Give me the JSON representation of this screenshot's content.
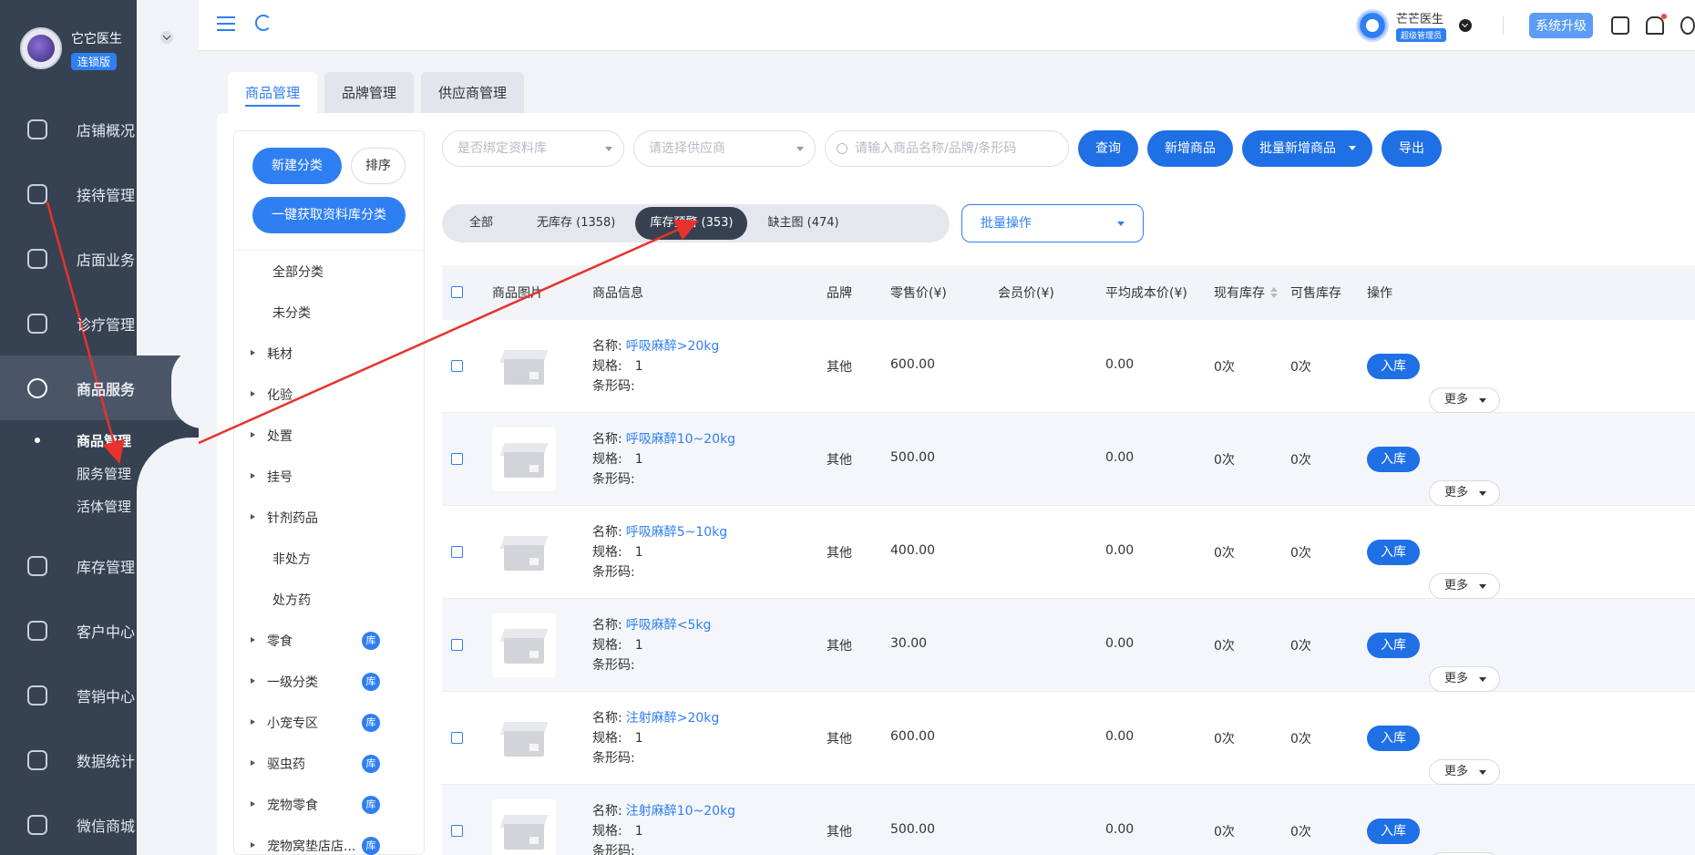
{
  "brand": {
    "name": "它它医生",
    "badge": "连锁版"
  },
  "sidebar": {
    "items": [
      {
        "label": "店铺概况",
        "icon": "store-overview-icon"
      },
      {
        "label": "接待管理",
        "icon": "reception-icon"
      },
      {
        "label": "店面业务",
        "icon": "storefront-icon"
      },
      {
        "label": "诊疗管理",
        "icon": "medical-kit-icon"
      },
      {
        "label": "商品服务",
        "icon": "goods-bag-icon"
      }
    ],
    "sub_items": [
      {
        "label": "商品管理",
        "active": true
      },
      {
        "label": "服务管理"
      },
      {
        "label": "活体管理"
      }
    ],
    "items_after": [
      {
        "label": "库存管理",
        "icon": "inventory-icon"
      },
      {
        "label": "客户中心",
        "icon": "customer-icon"
      },
      {
        "label": "营销中心",
        "icon": "marketing-icon"
      },
      {
        "label": "数据统计",
        "icon": "statistics-icon"
      },
      {
        "label": "微信商城",
        "icon": "wechat-mall-icon"
      }
    ]
  },
  "topbar": {
    "user_name": "芒芒医生",
    "user_role": "超级管理员",
    "upgrade_label": "系统升级"
  },
  "tabs": [
    {
      "label": "商品管理",
      "active": true
    },
    {
      "label": "品牌管理"
    },
    {
      "label": "供应商管理"
    }
  ],
  "categories": {
    "new_label": "新建分类",
    "sort_label": "排序",
    "fetch_label": "一键获取资料库分类",
    "list": [
      {
        "label": "全部分类",
        "type": "leaf"
      },
      {
        "label": "未分类",
        "type": "leaf"
      },
      {
        "label": "耗材",
        "type": "branch"
      },
      {
        "label": "化验",
        "type": "branch"
      },
      {
        "label": "处置",
        "type": "branch"
      },
      {
        "label": "挂号",
        "type": "branch"
      },
      {
        "label": "针剂药品",
        "type": "branch"
      },
      {
        "label": "非处方",
        "type": "leaf"
      },
      {
        "label": "处方药",
        "type": "leaf"
      },
      {
        "label": "零食",
        "type": "branch",
        "badge": "库"
      },
      {
        "label": "一级分类",
        "type": "branch",
        "badge": "库"
      },
      {
        "label": "小宠专区",
        "type": "branch",
        "badge": "库"
      },
      {
        "label": "驱虫药",
        "type": "branch",
        "badge": "库"
      },
      {
        "label": "宠物零食",
        "type": "branch",
        "badge": "库"
      },
      {
        "label": "宠物窝垫店店...",
        "type": "branch",
        "badge": "库"
      }
    ]
  },
  "filters": {
    "library_placeholder": "是否绑定资料库",
    "supplier_placeholder": "请选择供应商",
    "search_placeholder": "请输入商品名称/品牌/条形码",
    "query_label": "查询",
    "add_label": "新增商品",
    "batch_add_label": "批量新增商品",
    "export_label": "导出"
  },
  "status_tabs": [
    {
      "label": "全部"
    },
    {
      "label": "无库存 (1358)"
    },
    {
      "label": "库存预警 (353)",
      "active": true
    },
    {
      "label": "缺主图 (474)"
    }
  ],
  "batch_label": "批量操作",
  "table": {
    "headers": [
      "商品图片",
      "商品信息",
      "品牌",
      "零售价(¥)",
      "会员价(¥)",
      "平均成本价(¥)",
      "现有库存",
      "可售库存",
      "操作"
    ],
    "name_prefix": "名称:",
    "spec_prefix": "规格:",
    "barcode_prefix": "条形码:",
    "in_label": "入库",
    "more_label": "更多",
    "rows": [
      {
        "name": "呼吸麻醉>20kg",
        "spec": "1",
        "brand": "其他",
        "price": "600.00",
        "member": "",
        "cost": "0.00",
        "stock": "0次",
        "sellable": "0次"
      },
      {
        "name": "呼吸麻醉10~20kg",
        "spec": "1",
        "brand": "其他",
        "price": "500.00",
        "member": "",
        "cost": "0.00",
        "stock": "0次",
        "sellable": "0次"
      },
      {
        "name": "呼吸麻醉5~10kg",
        "spec": "1",
        "brand": "其他",
        "price": "400.00",
        "member": "",
        "cost": "0.00",
        "stock": "0次",
        "sellable": "0次"
      },
      {
        "name": "呼吸麻醉<5kg",
        "spec": "1",
        "brand": "其他",
        "price": "30.00",
        "member": "",
        "cost": "0.00",
        "stock": "0次",
        "sellable": "0次"
      },
      {
        "name": "注射麻醉>20kg",
        "spec": "1",
        "brand": "其他",
        "price": "600.00",
        "member": "",
        "cost": "0.00",
        "stock": "0次",
        "sellable": "0次"
      },
      {
        "name": "注射麻醉10~20kg",
        "spec": "1",
        "brand": "其他",
        "price": "500.00",
        "member": "",
        "cost": "0.00",
        "stock": "0次",
        "sellable": "0次"
      }
    ]
  },
  "colors": {
    "accent": "#2f7ff2",
    "sidebar": "#364152",
    "annotation": "#e8322b"
  }
}
